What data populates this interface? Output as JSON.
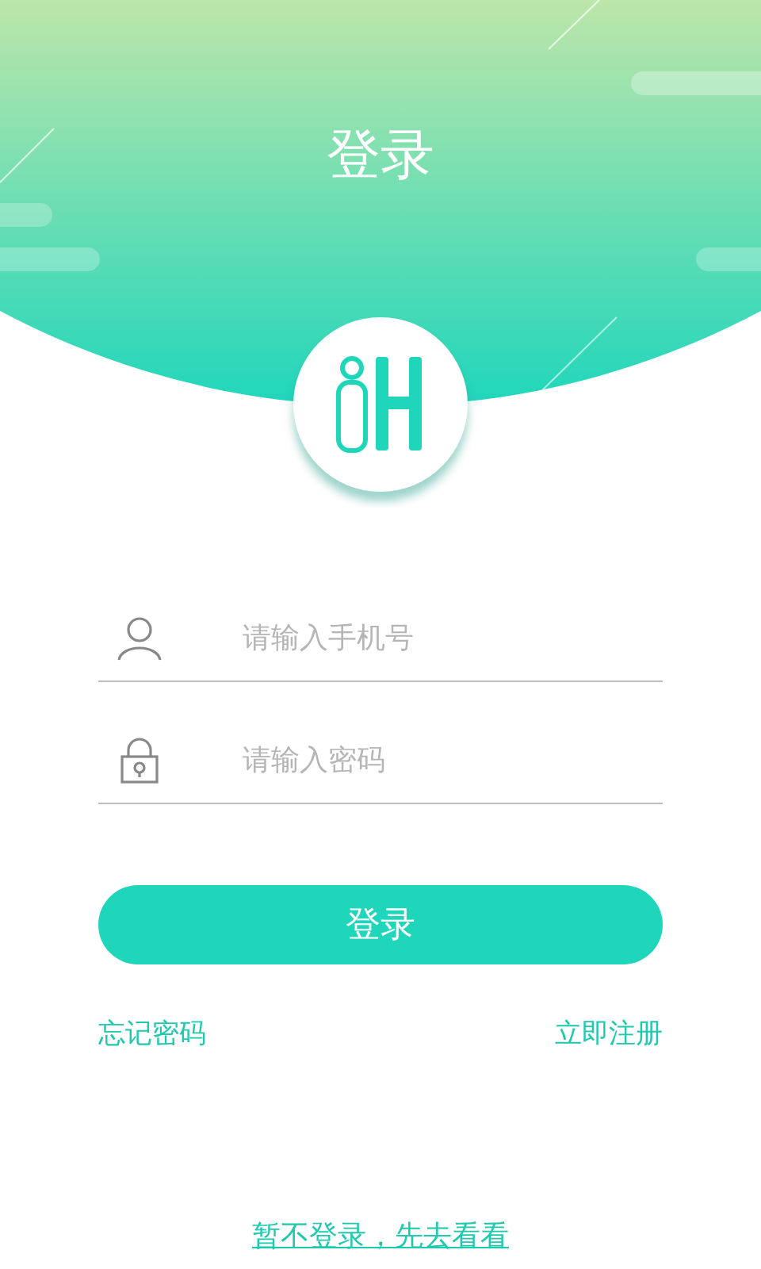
{
  "header": {
    "title": "登录"
  },
  "fields": [
    {
      "kind": "phone",
      "placeholder": "请输入手机号"
    },
    {
      "kind": "password",
      "placeholder": "请输入密码"
    }
  ],
  "login_button": "登录",
  "links": {
    "forgot": "忘记密码",
    "register": "立即注册"
  },
  "guest_link": "暂不登录，先去看看"
}
